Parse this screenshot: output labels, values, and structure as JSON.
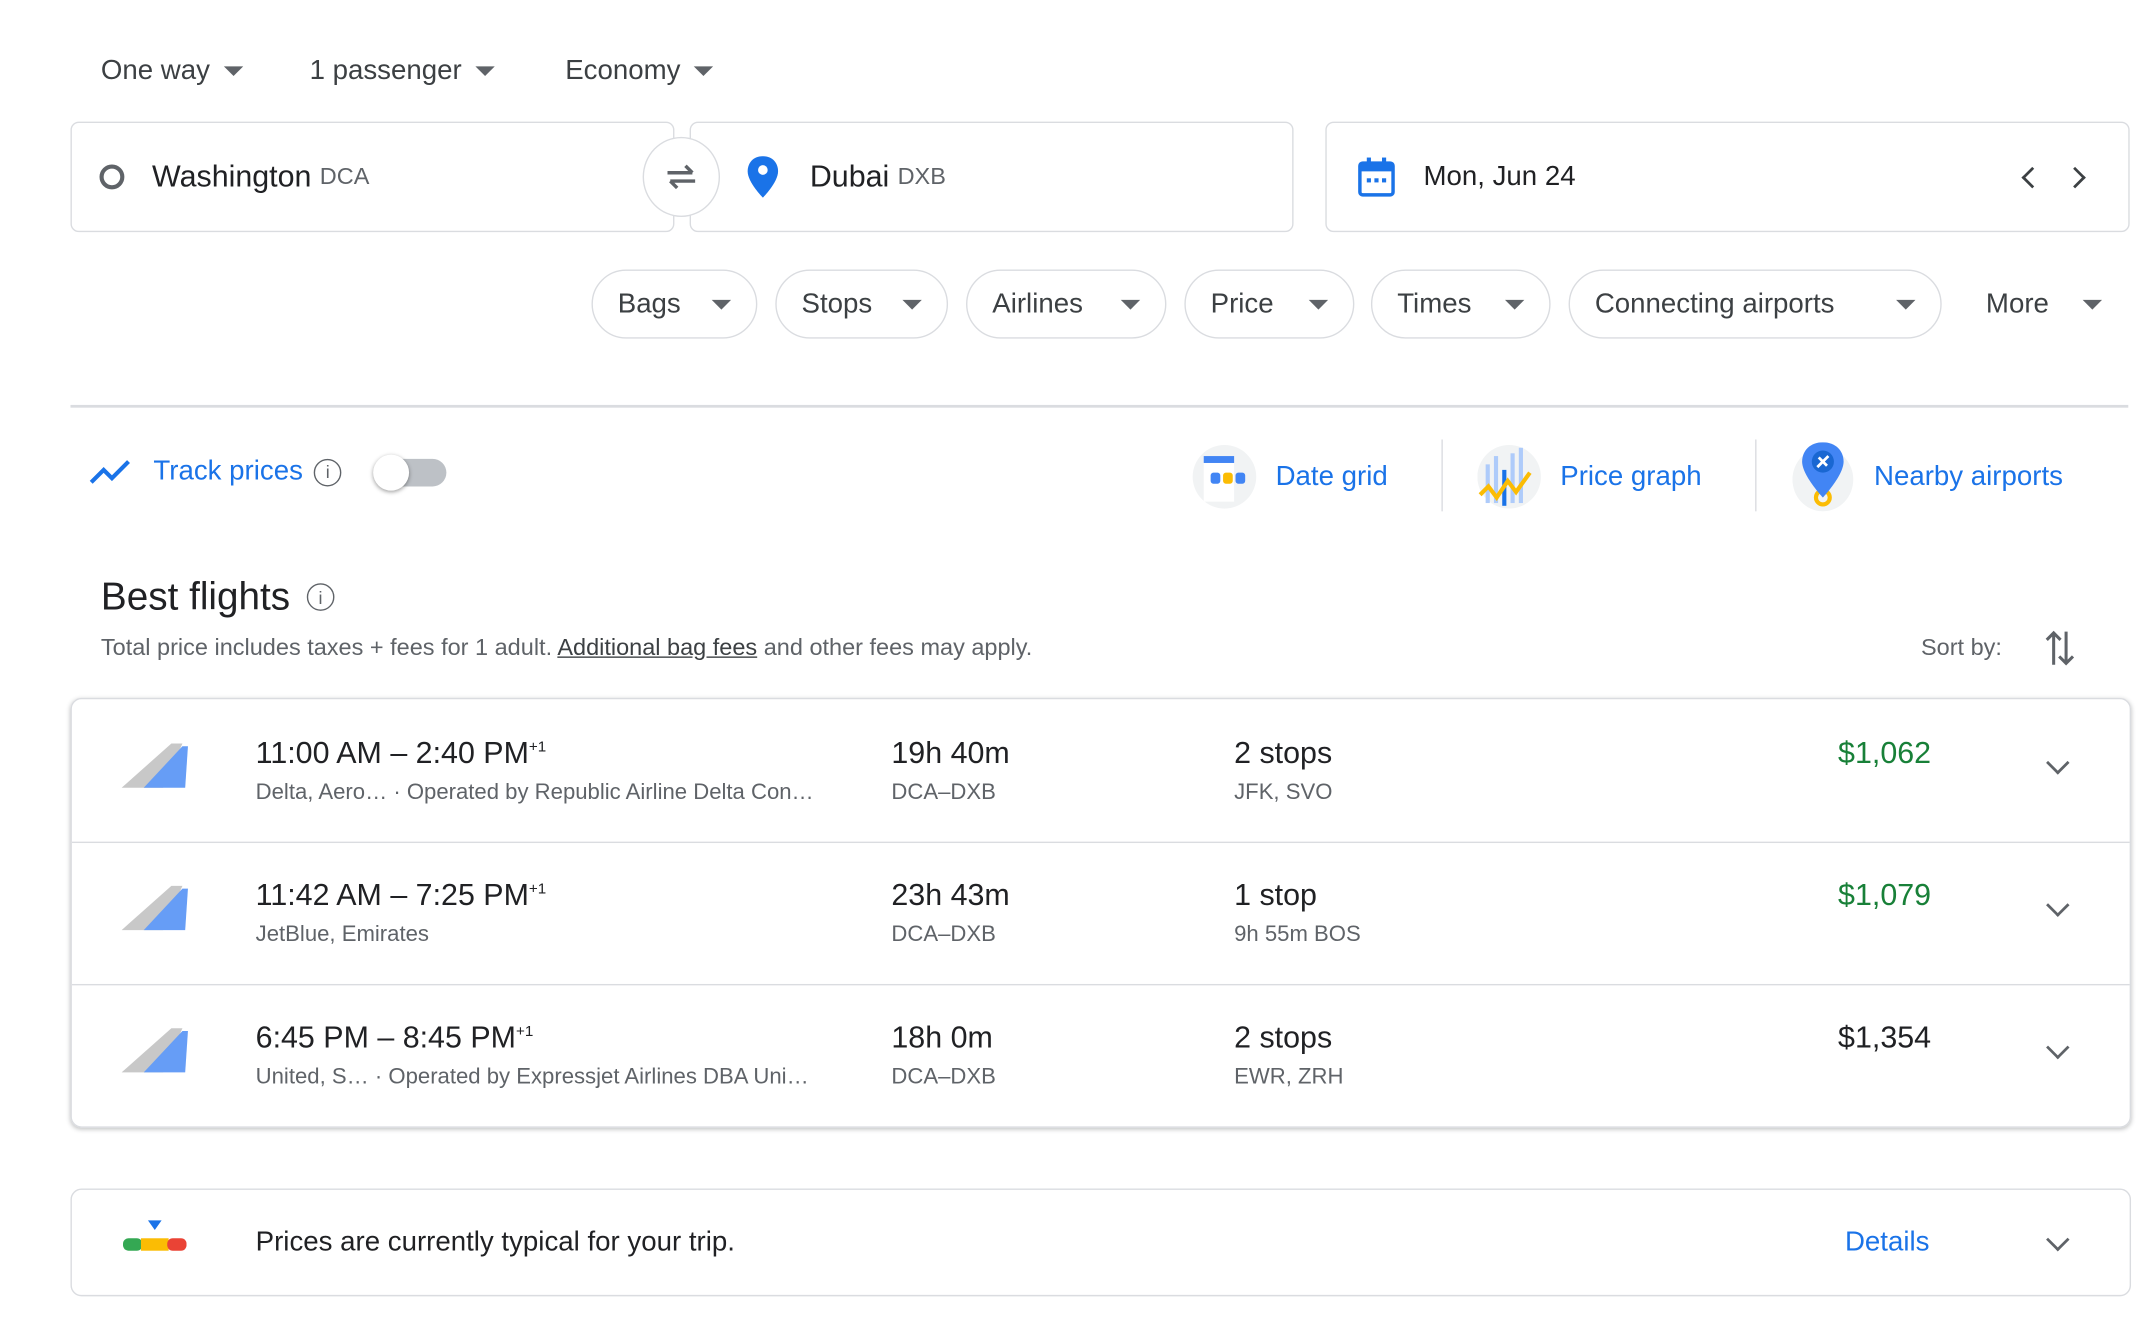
{
  "search": {
    "trip_type": "One way",
    "passengers": "1 passenger",
    "cabin": "Economy",
    "origin": {
      "city": "Washington",
      "code": "DCA"
    },
    "destination": {
      "city": "Dubai",
      "code": "DXB"
    },
    "date": "Mon, Jun 24"
  },
  "filters": [
    "Bags",
    "Stops",
    "Airlines",
    "Price",
    "Times",
    "Connecting airports",
    "More"
  ],
  "tools": {
    "track_prices": "Track prices",
    "track_enabled": false,
    "date_grid": "Date grid",
    "price_graph": "Price graph",
    "nearby_airports": "Nearby airports"
  },
  "results": {
    "title": "Best flights",
    "subtitle_pre": "Total price includes taxes + fees for 1 adult. ",
    "subtitle_link": "Additional bag fees",
    "subtitle_post": " and other fees may apply.",
    "sort_label": "Sort by:",
    "flights": [
      {
        "times": "11:00 AM – 2:40 PM",
        "plus": "+1",
        "airlines": "Delta, Aero…",
        "operated": "· Operated by Republic Airline Delta Con…",
        "duration": "19h 40m",
        "route": "DCA–DXB",
        "stops": "2 stops",
        "stop_detail": "JFK, SVO",
        "price": "$1,062",
        "price_color": "#188038"
      },
      {
        "times": "11:42 AM – 7:25 PM",
        "plus": "+1",
        "airlines": "JetBlue, Emirates",
        "operated": "",
        "duration": "23h 43m",
        "route": "DCA–DXB",
        "stops": "1 stop",
        "stop_detail": "9h 55m BOS",
        "price": "$1,079",
        "price_color": "#188038"
      },
      {
        "times": "6:45 PM – 8:45 PM",
        "plus": "+1",
        "airlines": "United, S…",
        "operated": "· Operated by Expressjet Airlines DBA Uni…",
        "duration": "18h 0m",
        "route": "DCA–DXB",
        "stops": "2 stops",
        "stop_detail": "EWR, ZRH",
        "price": "$1,354",
        "price_color": "#202124"
      }
    ]
  },
  "insight": {
    "text": "Prices are currently typical for your trip.",
    "details": "Details"
  }
}
